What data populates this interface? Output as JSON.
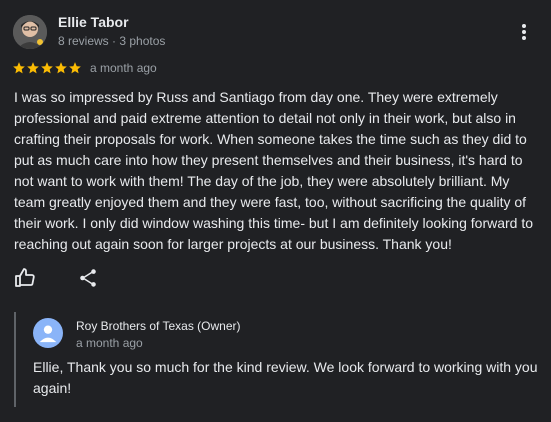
{
  "reviewer": {
    "name": "Ellie Tabor",
    "meta": "8 reviews · 3 photos"
  },
  "review": {
    "rating": 5,
    "max_rating": 5,
    "time": "a month ago",
    "text": "I was so impressed by Russ and Santiago from day one. They were extremely professional and paid extreme attention to detail not only in their work, but also in crafting their proposals for work. When someone takes the time such as they did to put as much care into how they present themselves and their business, it's hard to not want to work with them! The day of the job, they were absolutely brilliant. My team greatly enjoyed them and they were fast, too, without sacrificing the quality of their work. I only did window washing this time- but I am definitely looking forward to reaching out again soon for larger projects at our business. Thank you!"
  },
  "owner_response": {
    "name": "Roy Brothers of Texas (Owner)",
    "time": "a month ago",
    "text": "Ellie, Thank you so much for the kind review. We look forward to working with you again!"
  },
  "colors": {
    "background": "#202124",
    "star": "#fbbc04",
    "secondary_text": "#9aa0a6",
    "owner_avatar": "#8ab4f8"
  },
  "icons": {
    "like": "thumbs-up-icon",
    "share": "share-icon",
    "more": "more-vert-icon",
    "owner_avatar": "person-icon"
  }
}
